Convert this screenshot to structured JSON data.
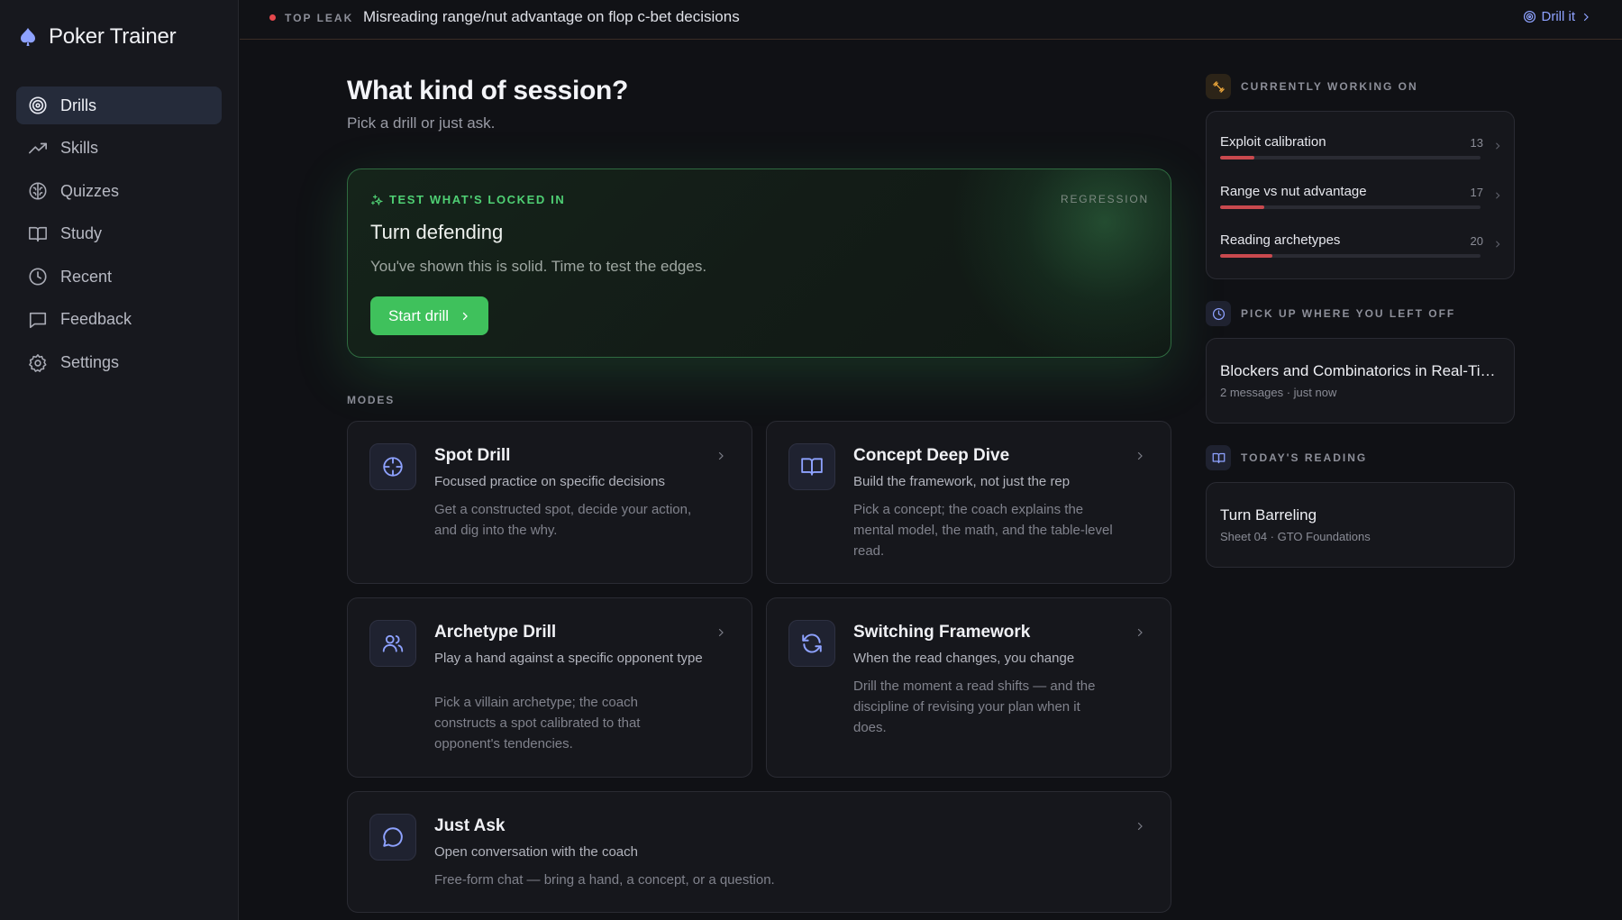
{
  "app": {
    "title": "Poker Trainer"
  },
  "sidebar": {
    "items": [
      {
        "label": "Drills",
        "icon": "target-icon",
        "active": true
      },
      {
        "label": "Skills",
        "icon": "trending-up-icon",
        "active": false
      },
      {
        "label": "Quizzes",
        "icon": "brain-icon",
        "active": false
      },
      {
        "label": "Study",
        "icon": "book-icon",
        "active": false
      },
      {
        "label": "Recent",
        "icon": "clock-icon",
        "active": false
      },
      {
        "label": "Feedback",
        "icon": "message-square-icon",
        "active": false
      },
      {
        "label": "Settings",
        "icon": "gear-icon",
        "active": false
      }
    ]
  },
  "leak": {
    "tag": "TOP LEAK",
    "text": "Misreading range/nut advantage on flop c-bet decisions",
    "action": "Drill it"
  },
  "main": {
    "title": "What kind of session?",
    "subtitle": "Pick a drill or just ask.",
    "hero": {
      "tag": "TEST WHAT'S LOCKED IN",
      "badge": "REGRESSION",
      "title": "Turn defending",
      "description": "You've shown this is solid. Time to test the edges.",
      "button": "Start drill"
    },
    "modes_label": "MODES",
    "modes": [
      {
        "title": "Spot Drill",
        "subtitle": "Focused practice on specific decisions",
        "description": "Get a constructed spot, decide your action, and dig into the why.",
        "icon": "crosshair-icon"
      },
      {
        "title": "Concept Deep Dive",
        "subtitle": "Build the framework, not just the rep",
        "description": "Pick a concept; the coach explains the mental model, the math, and the table-level read.",
        "icon": "open-book-icon"
      },
      {
        "title": "Archetype Drill",
        "subtitle": "Play a hand against a specific opponent type",
        "description": "Pick a villain archetype; the coach constructs a spot calibrated to that opponent's tendencies.",
        "icon": "users-icon"
      },
      {
        "title": "Switching Framework",
        "subtitle": "When the read changes, you change",
        "description": "Drill the moment a read shifts — and the discipline of revising your plan when it does.",
        "icon": "refresh-icon"
      },
      {
        "title": "Just Ask",
        "subtitle": "Open conversation with the coach",
        "description": "Free-form chat — bring a hand, a concept, or a question.",
        "icon": "chat-bubble-icon"
      }
    ]
  },
  "right": {
    "working": {
      "label": "CURRENTLY WORKING ON",
      "items": [
        {
          "name": "Exploit calibration",
          "count": "13",
          "progress": 0.13
        },
        {
          "name": "Range vs nut advantage",
          "count": "17",
          "progress": 0.17
        },
        {
          "name": "Reading archetypes",
          "count": "20",
          "progress": 0.2
        }
      ]
    },
    "resume": {
      "label": "PICK UP WHERE YOU LEFT OFF",
      "title": "Blockers and Combinatorics in Real-Time Play",
      "meta": "2 messages · just now"
    },
    "reading": {
      "label": "TODAY'S READING",
      "title": "Turn Barreling",
      "meta": "Sheet 04 · GTO Foundations"
    }
  },
  "colors": {
    "accent": "#8ea2ff",
    "success": "#3fc15c",
    "danger": "#e5484d",
    "progress": "#c9494e",
    "working_icon": "#f0a93b"
  }
}
